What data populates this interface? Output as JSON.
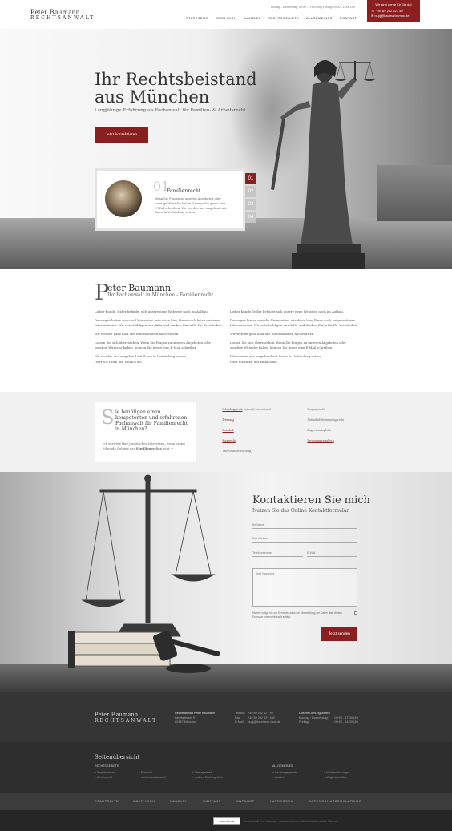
{
  "header": {
    "logo_line1": "Peter Baumann",
    "logo_line2": "RECHTSANWALT",
    "hours": "Montag - Donnerstag: 09:00 - 17:00 Uhr  |  Freitag: 09:00 - 14:00 Uhr",
    "nav": [
      "STARTSEITE",
      "ÜBER MICH",
      "KANZLEI",
      "RECHTSGEBIETE",
      "ALLGEMEINES",
      "KONTAKT"
    ],
    "callbox": {
      "title": "Wir sind gerne für Sie da!",
      "phone": "+49 89 262 627 40",
      "email": "ra.pj@baumann-muc.de"
    }
  },
  "hero": {
    "title_line1": "Ihr Rechtsbeistand",
    "title_line2": "aus München",
    "lead": "Langjährige Erfahrung als Fachanwalt für Familien- & Arbeitsrecht",
    "button": "Jetzt kontaktieren",
    "slider": {
      "number": "01",
      "title": "Familienrecht",
      "text": "Wenn Sie Fragen zu unseren Angeboten oder sonstige Wünsche haben, können Sie gerne eine E-Mail schreiben. Wir werden uns umgehend mit Ihnen in Verbindung setzen.",
      "tabs": [
        "01",
        "02",
        "03",
        "04"
      ]
    }
  },
  "intro": {
    "drop": "P",
    "title": "eter Baumann",
    "subtitle": "Ihr Fachanwalt in München - Familienrecht",
    "col1": [
      "Lieber Kunde, leider befindet sich unsere neue Webseite noch im Aufbau.",
      "Deswegen bieten manche Unterseiten, wie diese hier, Ihnen noch keine weiteren Informationen. Wir entschuldigen uns dafür und danken Ihnen für Ihr Verständnis.",
      "Wir werden ganz bald alle Informationen nachreichen.",
      "Lassen Sie sich überraschen. Wenn Sie Fragen zu unseren Angeboten oder sonstige Wünsche haben, können Sie gerne eine E-Mail schreiben.",
      "Wir werden uns umgehend mit Ihnen in Verbindung setzen.",
      "Oder Sie rufen uns einfach an!"
    ],
    "col2": [
      "Lieber Kunde, leider befindet sich unsere neue Webseite noch im Aufbau.",
      "Deswegen bieten manche Unterseiten, wie diese hier, Ihnen noch keine weiteren Informationen. Wir entschuldigen uns dafür und danken Ihnen für Ihr Verständnis.",
      "Wir werden ganz bald alle Informationen nachreichen.",
      "Lassen Sie sich überraschen. Wenn Sie Fragen zu unseren Angeboten oder sonstige Wünsche haben, können Sie gerne eine E-Mail schreiben.",
      "Wir werden uns umgehend mit Ihnen in Verbindung setzen.",
      "Oder Sie rufen uns einfach an!"
    ]
  },
  "services": {
    "drop": "S",
    "title": "ie benötigen einen kompetenten und erfahrenen Fachanwalt für Familienrecht in München?",
    "text_pre": "Ich vertrete Ihre juristischen Interessen, wenn es um folgende Gebiete des",
    "text_bold": "Familienrechts",
    "text_post": "geht →",
    "col1": [
      {
        "link": "Scheidungsrecht",
        "rest": ", national, international"
      },
      {
        "link": "Trennung",
        "rest": ""
      },
      {
        "link": "Unterhalt",
        "rest": ""
      },
      {
        "link": "Sorgerecht",
        "rest": ""
      },
      {
        "link": "",
        "rest": "Vaterschaftsfeststellung"
      }
    ],
    "col2": [
      {
        "link": "",
        "rest": "Umgangsrecht"
      },
      {
        "link": "",
        "rest": "Aufenthaltsbestimmungsrecht"
      },
      {
        "link": "",
        "rest": "Zugewinnausgleich"
      },
      {
        "link": "Versorgungsausgleich",
        "rest": ""
      }
    ]
  },
  "contact": {
    "title": "Kontaktieren Sie mich",
    "subtitle": "Nutzen Sie das Online Kontaktformular",
    "name_placeholder": "Ihr Name",
    "address_placeholder": "Ihre Adresse",
    "phone_placeholder": "Telefonnummer",
    "email_placeholder": "E-Mail",
    "message_placeholder": "Ihre Nachricht",
    "note": "Hiermit willige ich zur Kenntnis, dass die Übermittlung der Daten über dieses Formular unverschlüsselt erfolgt.",
    "button": "Jetzt senden"
  },
  "footer": {
    "logo_line1": "Peter Baumann",
    "logo_line2": "RECHTSANWALT",
    "address": [
      "Rechtsanwalt Peter Baumann",
      "Landwehrstr. 9",
      "80337 München"
    ],
    "tel_label": "Telefon:",
    "tel": "+49 89 262 627 40",
    "fax_label": "Fax:",
    "fax": "+49 89 262 627 430",
    "mail_label": "E-Mail:",
    "mail": "ra.pj@baumann-muc.de",
    "hours_title": "Unsere Öffnungszeiten",
    "hours": [
      [
        "Montag - Donnerstag:",
        "09:00 - 17:00 Uhr"
      ],
      [
        "Freitag:",
        "09:00 - 14:00 Uhr"
      ]
    ],
    "sitemap_title": "Seitenübersicht",
    "sitemap_col_title1": "RECHTSGEBIETE",
    "sitemap_col_title2": "ALLGEMEINES",
    "sitemap": [
      [
        "Familienrecht",
        "Arbeitsrecht"
      ],
      [
        "Erbrecht",
        "Verkehrsunfallrecht"
      ],
      [
        "Vertragsrecht",
        "weitere Rechtsgebiete"
      ],
      [
        "Beratungsgebiete",
        "Anfahrt"
      ],
      [
        "Veröffentlichungen",
        "Mitgliedschaften"
      ]
    ],
    "bottom_nav": [
      "STARTSEITE",
      "ÜBER MICH",
      "KANZLEI",
      "KONTAKT",
      "ANFAHRT",
      "IMPRESSUM",
      "DATENSCHUTZERKLÄRUNG"
    ],
    "badge": "muenchen.de",
    "copyright": "Rechtsanwalt Peter Baumann, auch bei muenchen.de für Familienrecht in München"
  }
}
